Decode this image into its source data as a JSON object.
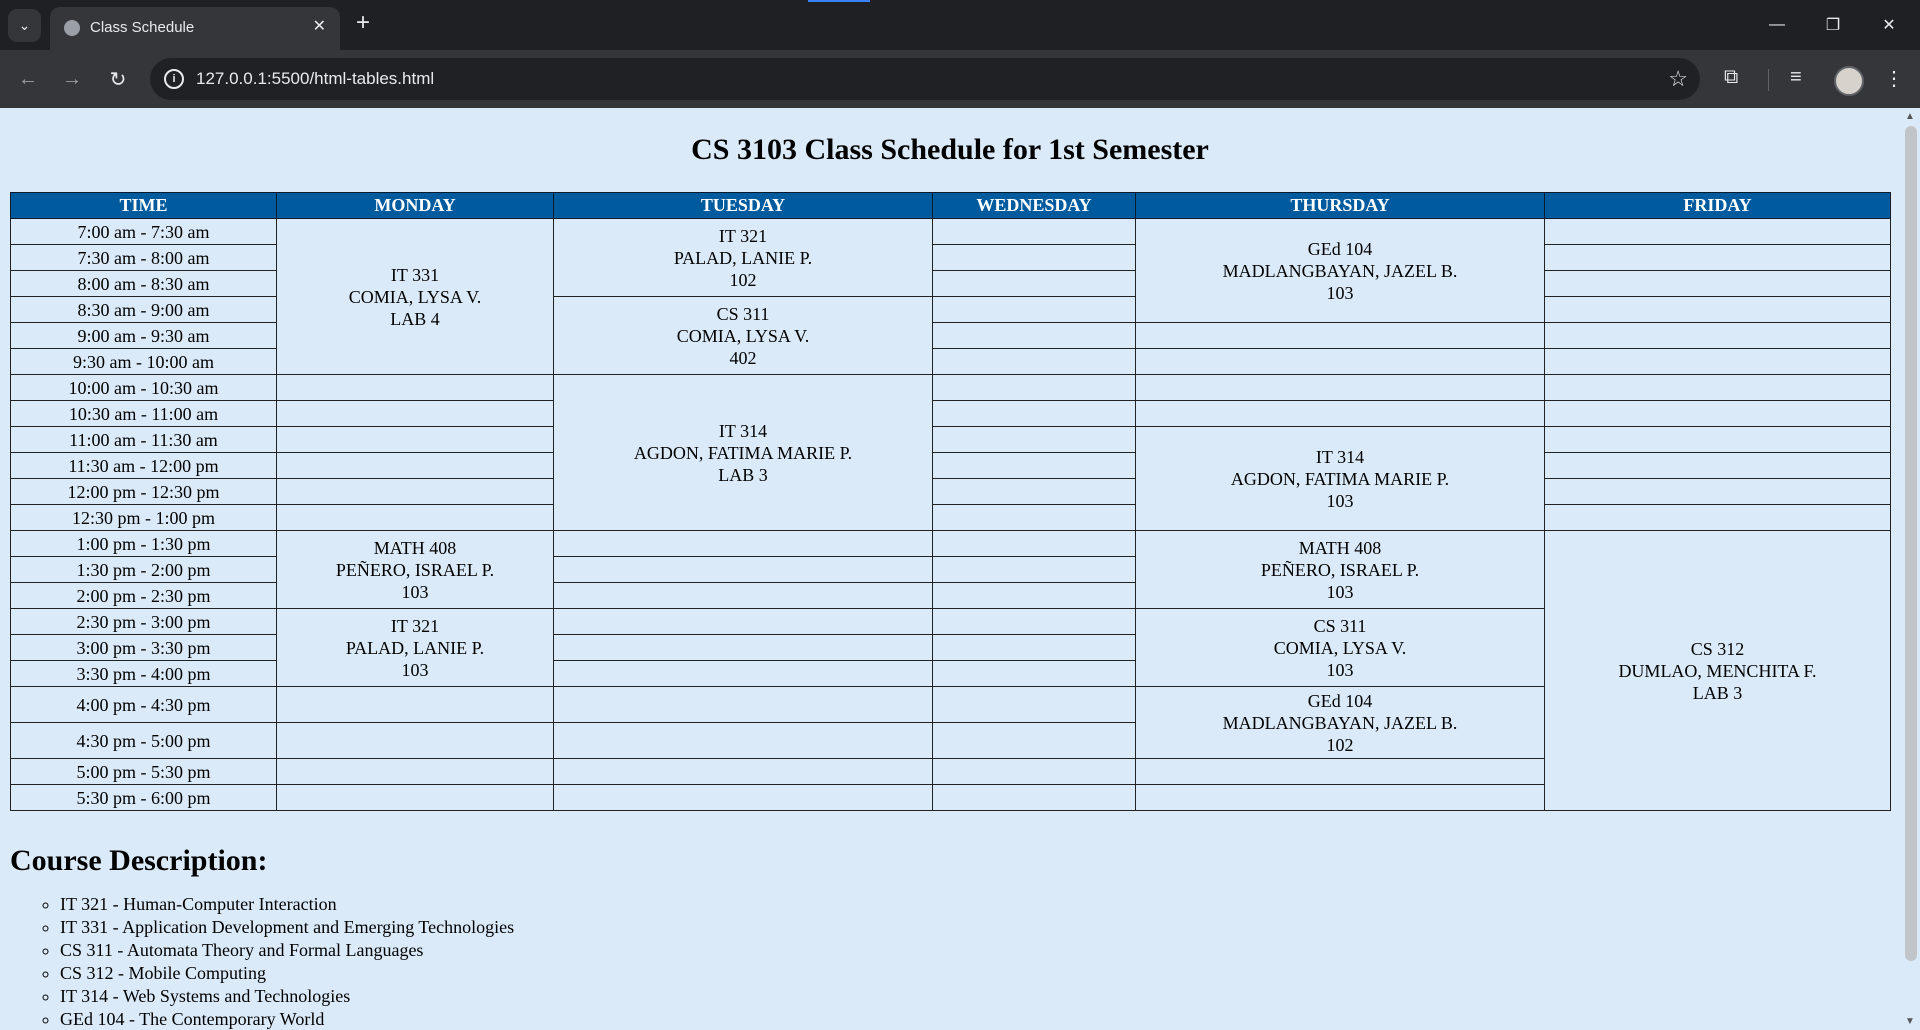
{
  "browser": {
    "tab_title": "Class Schedule",
    "url": "127.0.0.1:5500/html-tables.html"
  },
  "page": {
    "title": "CS 3103 Class Schedule for 1st Semester",
    "headers": [
      "TIME",
      "MONDAY",
      "TUESDAY",
      "WEDNESDAY",
      "THURSDAY",
      "FRIDAY"
    ],
    "times": [
      "7:00 am - 7:30 am",
      "7:30 am - 8:00 am",
      "8:00 am - 8:30 am",
      "8:30 am - 9:00 am",
      "9:00 am - 9:30 am",
      "9:30 am - 10:00 am",
      "10:00 am - 10:30 am",
      "10:30 am - 11:00 am",
      "11:00 am - 11:30 am",
      "11:30 am - 12:00 pm",
      "12:00 pm - 12:30 pm",
      "12:30 pm - 1:00 pm",
      "1:00 pm - 1:30 pm",
      "1:30 pm - 2:00 pm",
      "2:00 pm - 2:30 pm",
      "2:30 pm - 3:00 pm",
      "3:00 pm - 3:30 pm",
      "3:30 pm - 4:00 pm",
      "4:00 pm - 4:30 pm",
      "4:30 pm - 5:00 pm",
      "5:00 pm - 5:30 pm",
      "5:30 pm - 6:00 pm"
    ],
    "classes": {
      "mon_it331": [
        "IT 331",
        "COMIA, LYSA V.",
        "LAB 4"
      ],
      "mon_math408": [
        "MATH 408",
        "PEÑERO, ISRAEL P.",
        "103"
      ],
      "mon_it321": [
        "IT 321",
        "PALAD, LANIE P.",
        "103"
      ],
      "tue_it321": [
        "IT 321",
        "PALAD, LANIE P.",
        "102"
      ],
      "tue_cs311": [
        "CS 311",
        "COMIA, LYSA V.",
        "402"
      ],
      "tue_it314": [
        "IT 314",
        "AGDON, FATIMA MARIE P.",
        "LAB 3"
      ],
      "thu_ged104a": [
        "GEd 104",
        "MADLANGBAYAN, JAZEL B.",
        "103"
      ],
      "thu_it314": [
        "IT 314",
        "AGDON, FATIMA MARIE P.",
        "103"
      ],
      "thu_math408": [
        "MATH 408",
        "PEÑERO, ISRAEL P.",
        "103"
      ],
      "thu_cs311": [
        "CS 311",
        "COMIA, LYSA V.",
        "103"
      ],
      "thu_ged104b": [
        "GEd 104",
        "MADLANGBAYAN, JAZEL B.",
        "102"
      ],
      "fri_cs312": [
        "CS 312",
        "DUMLAO, MENCHITA F.",
        "LAB 3"
      ]
    },
    "description_title": "Course Description:",
    "descriptions": [
      "IT 321 - Human-Computer Interaction",
      "IT 331 - Application Development and Emerging Technologies",
      "CS 311 - Automata Theory and Formal Languages",
      "CS 312 - Mobile Computing",
      "IT 314 - Web Systems and Technologies",
      "GEd 104 - The Contemporary World"
    ]
  }
}
